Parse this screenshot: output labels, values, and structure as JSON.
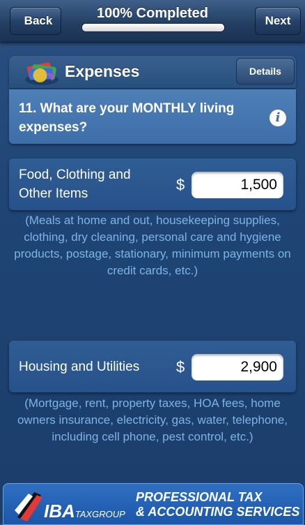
{
  "nav": {
    "back_label": "Back",
    "title": "100% Completed",
    "progress_percent": 100,
    "next_label": "Next"
  },
  "section": {
    "title": "Expenses",
    "details_label": "Details",
    "logo_icon": "expenses-logo-icon"
  },
  "question": {
    "text": "11. What are your MONTHLY living expenses?",
    "info_icon": "info-icon"
  },
  "rows": [
    {
      "label": "Food, Clothing and Other Items",
      "currency": "$",
      "value": "1,500",
      "hint": "(Meals at home and out, housekeeping supplies, clothing, dry cleaning, personal care and hygiene products, postage, stationary, minimum payments on credit cards, etc.)"
    },
    {
      "label": "Housing and Utilities",
      "currency": "$",
      "value": "2,900",
      "hint": "(Mortgage, rent, property taxes, HOA fees, home owners insurance, electricity, gas, water, telephone, including cell phone, pest control, etc.)"
    }
  ],
  "footer": {
    "brand": "IBA",
    "brand_sub": "TAXGROUP",
    "line1": "PROFESSIONAL TAX",
    "line2": "& ACCOUNTING SERVICES"
  },
  "colors": {
    "background": "#1f4575",
    "question_bg": "#3e6ea8",
    "hint_text": "#7fb2e6",
    "footer_bg": "#1b56a8"
  }
}
